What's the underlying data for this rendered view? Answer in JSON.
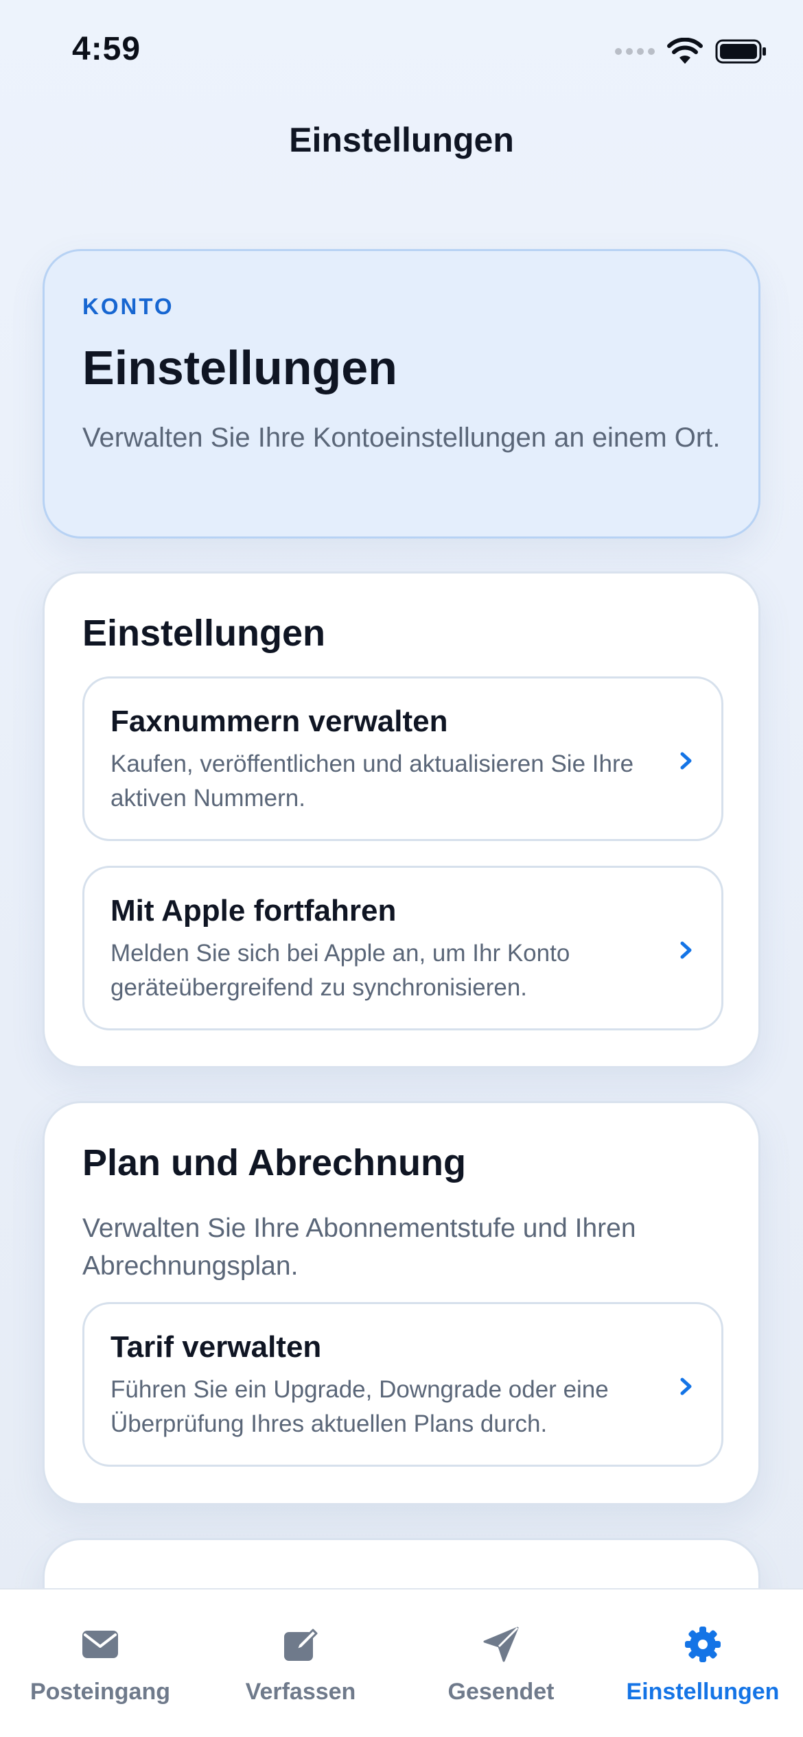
{
  "status_bar": {
    "time": "4:59"
  },
  "nav": {
    "title": "Einstellungen"
  },
  "hero": {
    "eyebrow": "KONTO",
    "title": "Einstellungen",
    "subtitle": "Verwalten Sie Ihre Kontoeinstellungen an einem Ort."
  },
  "settings_section": {
    "title": "Einstellungen",
    "items": [
      {
        "title": "Faxnummern verwalten",
        "subtitle": "Kaufen, veröffentlichen und aktualisieren Sie Ihre aktiven Nummern."
      },
      {
        "title": "Mit Apple fortfahren",
        "subtitle": "Melden Sie sich bei Apple an, um Ihr Konto geräteübergreifend zu synchronisieren."
      }
    ]
  },
  "plan_section": {
    "title": "Plan und Abrechnung",
    "description": "Verwalten Sie Ihre Abonnementstufe und Ihren Abrechnungsplan.",
    "items": [
      {
        "title": "Tarif verwalten",
        "subtitle": "Führen Sie ein Upgrade, Downgrade oder eine Überprüfung Ihres aktuellen Plans durch."
      }
    ]
  },
  "tabs": [
    {
      "label": "Posteingang",
      "icon": "envelope-icon",
      "active": false
    },
    {
      "label": "Verfassen",
      "icon": "compose-icon",
      "active": false
    },
    {
      "label": "Gesendet",
      "icon": "paper-plane-icon",
      "active": false
    },
    {
      "label": "Einstellungen",
      "icon": "gear-icon",
      "active": true
    }
  ],
  "colors": {
    "accent": "#1474e6",
    "inactive_tab": "#6f7a8b",
    "hero_background": "#e4eefc"
  }
}
